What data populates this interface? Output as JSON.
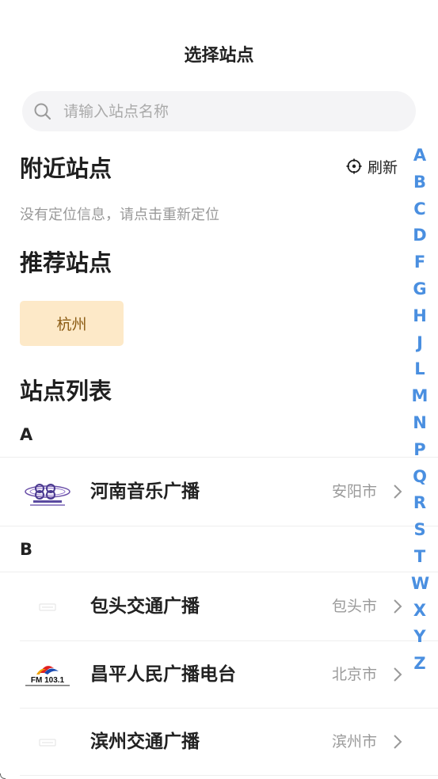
{
  "header": {
    "title": "选择站点"
  },
  "search": {
    "placeholder": "请输入站点名称"
  },
  "nearby": {
    "heading": "附近站点",
    "refresh_label": "刷新",
    "hint": "没有定位信息，请点击重新定位"
  },
  "recommended": {
    "heading": "推荐站点",
    "items": [
      {
        "label": "杭州"
      }
    ]
  },
  "list": {
    "heading": "站点列表",
    "groups": [
      {
        "letter": "A",
        "stations": [
          {
            "name": "河南音乐广播",
            "city": "安阳市",
            "logo": "henan-music-logo"
          }
        ]
      },
      {
        "letter": "B",
        "stations": [
          {
            "name": "包头交通广播",
            "city": "包头市",
            "logo": "placeholder-logo"
          },
          {
            "name": "昌平人民广播电台",
            "city": "北京市",
            "logo": "fm-103-logo",
            "logo_text": "FM 103.1"
          },
          {
            "name": "滨州交通广播",
            "city": "滨州市",
            "logo": "placeholder-logo"
          }
        ]
      }
    ]
  },
  "index_letters": [
    "A",
    "B",
    "C",
    "D",
    "F",
    "G",
    "H",
    "J",
    "L",
    "M",
    "N",
    "P",
    "Q",
    "R",
    "S",
    "T",
    "W",
    "X",
    "Y",
    "Z"
  ],
  "colors": {
    "accent": "#4a8fe0",
    "chip_bg": "#fde9c8",
    "chip_text": "#8a5a12",
    "muted": "#999999",
    "search_bg": "#f4f4f6"
  }
}
